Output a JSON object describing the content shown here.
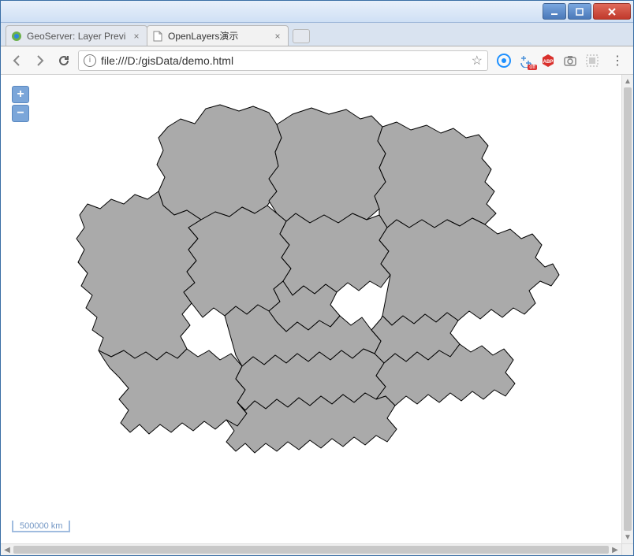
{
  "window_controls": {
    "minimize": "minimize",
    "maximize": "maximize",
    "close": "close"
  },
  "tabs": [
    {
      "title": "GeoServer: Layer Previ",
      "active": false,
      "favicon": "geoserver"
    },
    {
      "title": "OpenLayers演示",
      "active": true,
      "favicon": "file"
    }
  ],
  "address_bar": {
    "url": "file:///D:/gisData/demo.html",
    "info_icon": "i",
    "star_icon": "☆"
  },
  "extensions": [
    {
      "name": "qq-browser-ext",
      "glyph": "Q",
      "color": "#1e90ff"
    },
    {
      "name": "translate-ext",
      "glyph": "⇄",
      "color": "#4a90d9",
      "badge": "off"
    },
    {
      "name": "adblock-ext",
      "glyph": "ABP",
      "color": "#d9302c"
    },
    {
      "name": "screenshot-ext",
      "glyph": "📷",
      "color": "#888"
    },
    {
      "name": "blocked-ext",
      "glyph": "▦",
      "color": "#aaa"
    }
  ],
  "map": {
    "zoom_in_label": "+",
    "zoom_out_label": "−",
    "scale_label": "500000 km"
  },
  "browser_menu": {
    "dots": "⋮"
  }
}
